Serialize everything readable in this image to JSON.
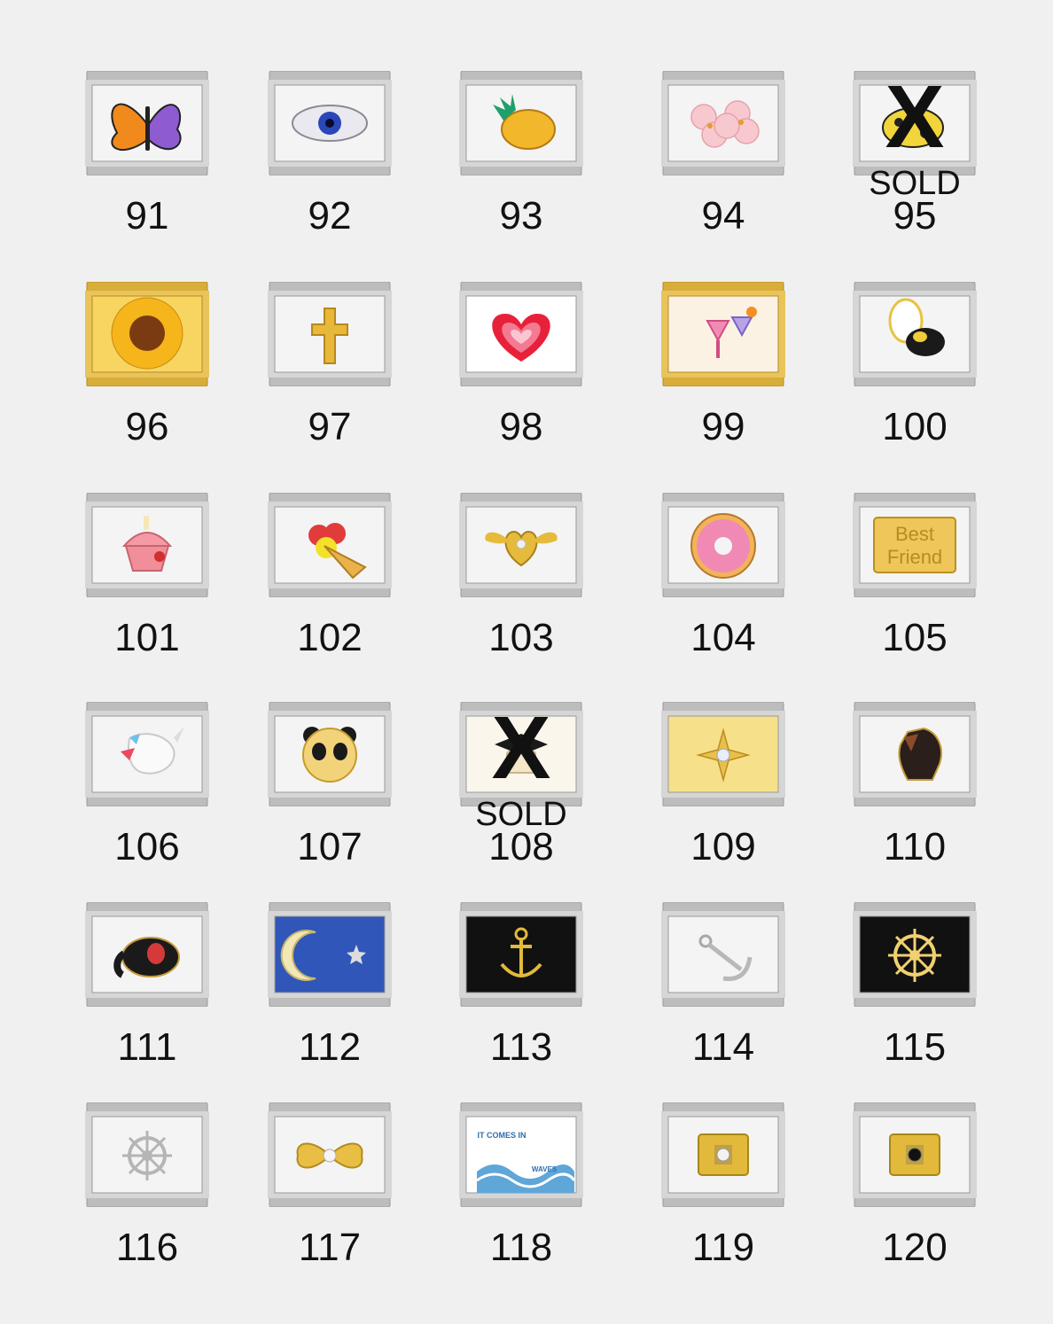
{
  "sold_mark": "X",
  "sold_label": "SOLD",
  "colors": {
    "background": "#f0f0f0",
    "steel": "#c9c9c9",
    "gold": "#e2b93b"
  },
  "charms": [
    {
      "number": "91",
      "icon": "butterfly-icon",
      "plate": "steel",
      "face": "#f4f4f4"
    },
    {
      "number": "92",
      "icon": "evil-eye-icon",
      "plate": "steel",
      "face": "#f4f4f4"
    },
    {
      "number": "93",
      "icon": "pineapple-icon",
      "plate": "steel",
      "face": "#f4f4f4"
    },
    {
      "number": "94",
      "icon": "blossom-icon",
      "plate": "steel",
      "face": "#f4f4f4"
    },
    {
      "number": "95",
      "icon": "dog-icon",
      "plate": "steel",
      "face": "#f4f4f4",
      "sold": true
    },
    {
      "number": "96",
      "icon": "sunflower-icon",
      "plate": "gold",
      "face": "#f7d560"
    },
    {
      "number": "97",
      "icon": "cross-icon",
      "plate": "steel",
      "face": "#f4f4f4"
    },
    {
      "number": "98",
      "icon": "heart-icon",
      "plate": "steel",
      "face": "#ffffff"
    },
    {
      "number": "99",
      "icon": "cocktail-icon",
      "plate": "gold",
      "face": "#fbf2e4"
    },
    {
      "number": "100",
      "icon": "bee-icon",
      "plate": "steel",
      "face": "#f4f4f4"
    },
    {
      "number": "101",
      "icon": "cupcake-icon",
      "plate": "steel",
      "face": "#f4f4f4"
    },
    {
      "number": "102",
      "icon": "ice-cream-icon",
      "plate": "steel",
      "face": "#f4f4f4"
    },
    {
      "number": "103",
      "icon": "winged-heart-icon",
      "plate": "steel",
      "face": "#f4f4f4"
    },
    {
      "number": "104",
      "icon": "donut-icon",
      "plate": "steel",
      "face": "#f4f4f4"
    },
    {
      "number": "105",
      "icon": "best-friend-plaque-icon",
      "plate": "steel",
      "face": "#f4f4f4",
      "text": [
        "Best",
        "Friend"
      ]
    },
    {
      "number": "106",
      "icon": "unicorn-icon",
      "plate": "steel",
      "face": "#f4f4f4"
    },
    {
      "number": "107",
      "icon": "panda-icon",
      "plate": "steel",
      "face": "#f4f4f4"
    },
    {
      "number": "108",
      "icon": "graduation-cap-icon",
      "plate": "steel",
      "face": "#fbf6ec",
      "sold": true
    },
    {
      "number": "109",
      "icon": "star-crystal-icon",
      "plate": "steel",
      "face": "#f7e08a"
    },
    {
      "number": "110",
      "icon": "horse-icon",
      "plate": "steel",
      "face": "#f4f4f4"
    },
    {
      "number": "111",
      "icon": "elephant-icon",
      "plate": "steel",
      "face": "#f4f4f4"
    },
    {
      "number": "112",
      "icon": "moon-star-icon",
      "plate": "steel",
      "face": "#2f56b8"
    },
    {
      "number": "113",
      "icon": "anchor-icon",
      "plate": "steel",
      "face": "#111111"
    },
    {
      "number": "114",
      "icon": "silver-anchor-icon",
      "plate": "steel",
      "face": "#f4f4f4"
    },
    {
      "number": "115",
      "icon": "ship-wheel-icon",
      "plate": "steel",
      "face": "#111111"
    },
    {
      "number": "116",
      "icon": "silver-wheel-icon",
      "plate": "steel",
      "face": "#f4f4f4"
    },
    {
      "number": "117",
      "icon": "bow-icon",
      "plate": "steel",
      "face": "#f4f4f4"
    },
    {
      "number": "118",
      "icon": "waves-icon",
      "plate": "steel",
      "face": "#ffffff",
      "text": [
        "IT COMES IN",
        "WAVES"
      ]
    },
    {
      "number": "119",
      "icon": "clear-stone-icon",
      "plate": "steel",
      "face": "#f4f4f4"
    },
    {
      "number": "120",
      "icon": "black-stone-icon",
      "plate": "steel",
      "face": "#f4f4f4"
    }
  ]
}
